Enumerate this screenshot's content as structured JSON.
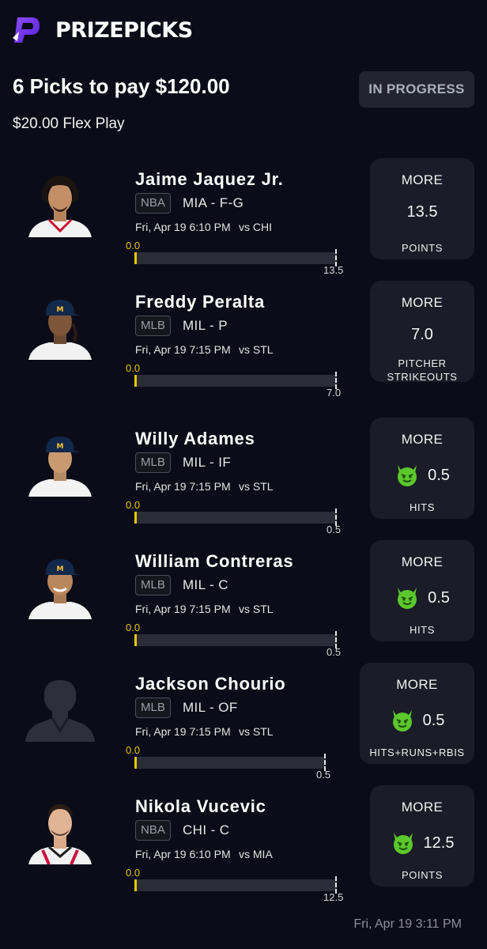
{
  "header": {
    "brand": "PRIZEPICKS",
    "logo_icon": "prizepicks-logo-icon"
  },
  "entry": {
    "title": "6 Picks to pay $120.00",
    "subtitle": "$20.00 Flex Play",
    "status": "IN PROGRESS"
  },
  "colors": {
    "background": "#0b0c18",
    "card": "#1a1c28",
    "progress": "#e8c600",
    "demon": "#5cc72c"
  },
  "picks": [
    {
      "player": "Jaime Jaquez Jr.",
      "league": "NBA",
      "team_pos": "MIA - F-G",
      "game_time": "Fri, Apr 19 6:10 PM",
      "opponent": "vs CHI",
      "current": "0.0",
      "target": "13.5",
      "direction": "MORE",
      "line": "13.5",
      "stat_line1": "POINTS",
      "stat_line2": "",
      "demon": false
    },
    {
      "player": "Freddy Peralta",
      "league": "MLB",
      "team_pos": "MIL - P",
      "game_time": "Fri, Apr 19 7:15 PM",
      "opponent": "vs STL",
      "current": "0.0",
      "target": "7.0",
      "direction": "MORE",
      "line": "7.0",
      "stat_line1": "PITCHER",
      "stat_line2": "STRIKEOUTS",
      "demon": false
    },
    {
      "player": "Willy Adames",
      "league": "MLB",
      "team_pos": "MIL - IF",
      "game_time": "Fri, Apr 19 7:15 PM",
      "opponent": "vs STL",
      "current": "0.0",
      "target": "0.5",
      "direction": "MORE",
      "line": "0.5",
      "stat_line1": "HITS",
      "stat_line2": "",
      "demon": true
    },
    {
      "player": "William Contreras",
      "league": "MLB",
      "team_pos": "MIL - C",
      "game_time": "Fri, Apr 19 7:15 PM",
      "opponent": "vs STL",
      "current": "0.0",
      "target": "0.5",
      "direction": "MORE",
      "line": "0.5",
      "stat_line1": "HITS",
      "stat_line2": "",
      "demon": true
    },
    {
      "player": "Jackson Chourio",
      "league": "MLB",
      "team_pos": "MIL - OF",
      "game_time": "Fri, Apr 19 7:15 PM",
      "opponent": "vs STL",
      "current": "0.0",
      "target": "0.5",
      "direction": "MORE",
      "line": "0.5",
      "stat_line1": "HITS+RUNS+RBIS",
      "stat_line2": "",
      "demon": true
    },
    {
      "player": "Nikola Vucevic",
      "league": "NBA",
      "team_pos": "CHI - C",
      "game_time": "Fri, Apr 19 6:10 PM",
      "opponent": "vs MIA",
      "current": "0.0",
      "target": "12.5",
      "direction": "MORE",
      "line": "12.5",
      "stat_line1": "POINTS",
      "stat_line2": "",
      "demon": true
    }
  ],
  "timestamp": "Fri, Apr 19 3:11 PM"
}
